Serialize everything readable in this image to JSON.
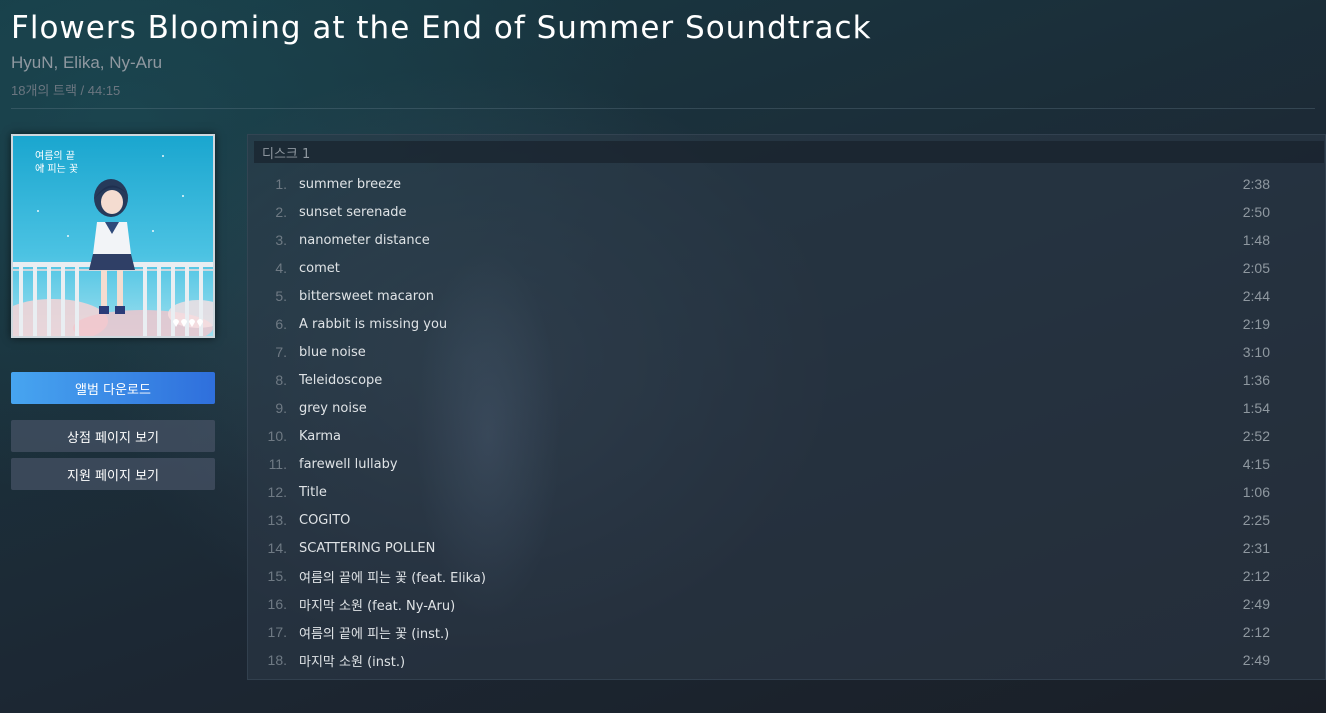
{
  "album": {
    "title": "Flowers Blooming at the End of Summer Soundtrack",
    "artists": "HyuN, Elika, Ny-Aru",
    "meta": "18개의 트랙 / 44:15",
    "cover_text": "여름의 끝에 피는 꽃",
    "cover_colors": {
      "sky_top": "#1aa6cf",
      "sky_bottom": "#7fd7ee",
      "railing": "#e9eef2",
      "clouds": "#f6d3d6"
    }
  },
  "buttons": {
    "download": "앨범 다운로드",
    "store": "상점 페이지 보기",
    "support": "지원 페이지 보기"
  },
  "disc": {
    "label": "디스크 1"
  },
  "tracks": [
    {
      "num": "1.",
      "title": "summer breeze",
      "duration": "2:38"
    },
    {
      "num": "2.",
      "title": "sunset serenade",
      "duration": "2:50"
    },
    {
      "num": "3.",
      "title": "nanometer distance",
      "duration": "1:48"
    },
    {
      "num": "4.",
      "title": "comet",
      "duration": "2:05"
    },
    {
      "num": "5.",
      "title": "bittersweet macaron",
      "duration": "2:44"
    },
    {
      "num": "6.",
      "title": "A rabbit is missing you",
      "duration": "2:19"
    },
    {
      "num": "7.",
      "title": "blue noise",
      "duration": "3:10"
    },
    {
      "num": "8.",
      "title": "Teleidoscope",
      "duration": "1:36"
    },
    {
      "num": "9.",
      "title": "grey noise",
      "duration": "1:54"
    },
    {
      "num": "10.",
      "title": "Karma",
      "duration": "2:52"
    },
    {
      "num": "11.",
      "title": "farewell lullaby",
      "duration": "4:15"
    },
    {
      "num": "12.",
      "title": "Title",
      "duration": "1:06"
    },
    {
      "num": "13.",
      "title": "COGITO",
      "duration": "2:25"
    },
    {
      "num": "14.",
      "title": "SCATTERING POLLEN",
      "duration": "2:31"
    },
    {
      "num": "15.",
      "title": "여름의 끝에 피는 꽃 (feat. Elika)",
      "duration": "2:12"
    },
    {
      "num": "16.",
      "title": "마지막 소원 (feat. Ny-Aru)",
      "duration": "2:49"
    },
    {
      "num": "17.",
      "title": "여름의 끝에 피는 꽃 (inst.)",
      "duration": "2:12"
    },
    {
      "num": "18.",
      "title": "마지막 소원 (inst.)",
      "duration": "2:49"
    }
  ]
}
